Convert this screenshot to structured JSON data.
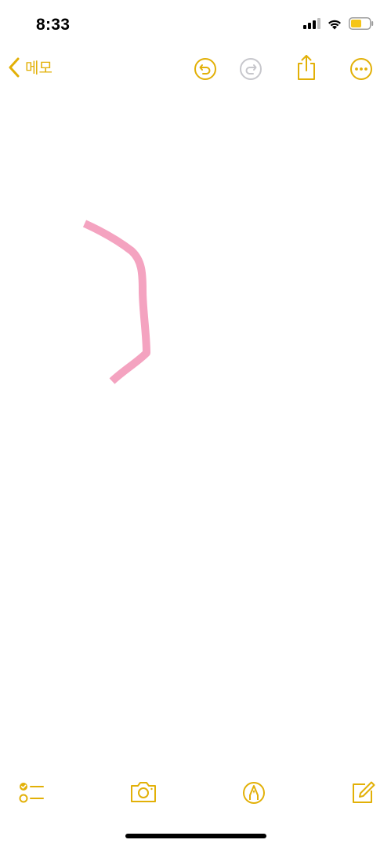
{
  "status_bar": {
    "time": "8:33",
    "icons": [
      "cellular-signal-icon",
      "wifi-icon",
      "battery-icon"
    ],
    "battery_color": "#F5C518"
  },
  "nav": {
    "back_label": "메모",
    "buttons": [
      "undo-icon",
      "redo-icon",
      "share-icon",
      "more-icon"
    ],
    "redo_enabled": false
  },
  "canvas": {
    "stroke_color": "#F4A3C0",
    "tool": "highlighter"
  },
  "toolbar": {
    "buttons": [
      "checklist-icon",
      "camera-icon",
      "markup-pen-icon",
      "compose-icon"
    ]
  },
  "colors": {
    "accent": "#E2B007",
    "disabled": "#C7C7CC",
    "background": "#FFFFFF"
  }
}
